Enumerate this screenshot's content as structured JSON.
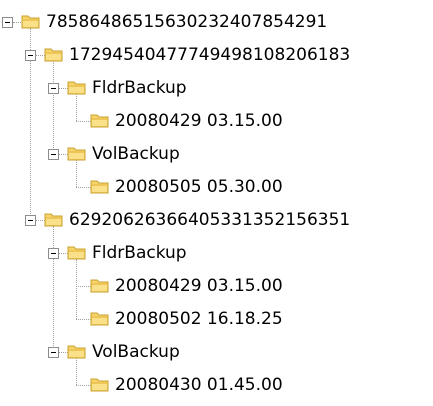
{
  "tree": {
    "root": {
      "label": "785864865156302324078542​91",
      "children": [
        {
          "label": "17294540477749498108206183",
          "children": [
            {
              "label": "FldrBackup",
              "children": [
                {
                  "label": "20080429 03.15.00"
                }
              ]
            },
            {
              "label": "VolBackup",
              "children": [
                {
                  "label": "20080505 05.30.00"
                }
              ]
            }
          ]
        },
        {
          "label": "62920626366405331352156351",
          "children": [
            {
              "label": "FldrBackup",
              "children": [
                {
                  "label": "20080429 03.15.00"
                },
                {
                  "label": "20080502 16.18.25"
                }
              ]
            },
            {
              "label": "VolBackup",
              "children": [
                {
                  "label": "20080430 01.45.00"
                }
              ]
            }
          ]
        }
      ]
    }
  },
  "colors": {
    "folder_fill": "#f5d46a",
    "folder_stroke": "#c8a030",
    "tree_lines": "#a0a0a0"
  }
}
